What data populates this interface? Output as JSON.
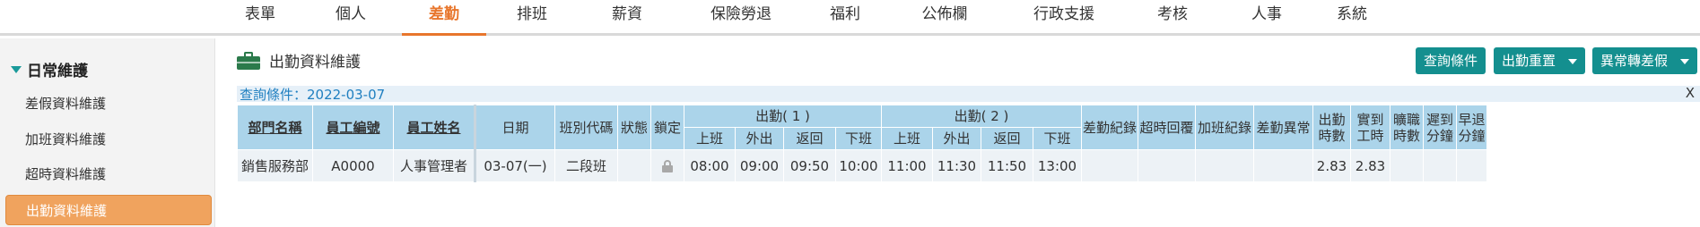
{
  "topnav": {
    "tabs": [
      {
        "label": "表單"
      },
      {
        "label": "個人"
      },
      {
        "label": "差勤"
      },
      {
        "label": "排班"
      },
      {
        "label": "薪資"
      },
      {
        "label": "保險勞退"
      },
      {
        "label": "福利"
      },
      {
        "label": "公佈欄"
      },
      {
        "label": "行政支援"
      },
      {
        "label": "考核"
      },
      {
        "label": "人事"
      },
      {
        "label": "系統"
      }
    ],
    "active_tab": "差勤"
  },
  "sidebar": {
    "group_title": "日常維護",
    "items": [
      {
        "label": "差假資料維護"
      },
      {
        "label": "加班資料維護"
      },
      {
        "label": "超時資料維護"
      },
      {
        "label": "出勤資料維護"
      }
    ],
    "active_item": "出勤資料維護"
  },
  "main": {
    "page_title": "出勤資料維護",
    "buttons": {
      "query": "查詢條件",
      "reset": "出勤重置",
      "convert": "異常轉差假"
    },
    "query_bar": {
      "text": "查詢條件：2022-03-07",
      "close": "X"
    },
    "table": {
      "headers": {
        "dept": "部門名稱",
        "emp_no": "員工編號",
        "emp_name": "員工姓名",
        "date": "日期",
        "shift_code": "班別代碼",
        "status": "狀態",
        "locked": "鎖定",
        "attend1": "出勤( 1 )",
        "attend2": "出勤( 2 )",
        "on": "上班",
        "out": "外出",
        "back": "返回",
        "off": "下班",
        "leave_rec": "差勤紀錄",
        "overtime_reply": "超時回覆",
        "ot_rec": "加班紀錄",
        "abnormal": "差勤異常",
        "attend_hours": "出勤時數",
        "actual_hours": "實到工時",
        "absent_hours": "曠職時數",
        "late_min": "遲到分鐘",
        "early_min": "早退分鐘"
      },
      "rows": [
        {
          "dept": "銷售服務部",
          "emp_no": "A0000",
          "emp_name": "人事管理者",
          "date": "03-07(一)",
          "shift_code": "二段班",
          "status": "",
          "a1_on": "08:00",
          "a1_out": "09:00",
          "a1_back": "09:50",
          "a1_off": "10:00",
          "a2_on": "11:00",
          "a2_out": "11:30",
          "a2_back": "11:50",
          "a2_off": "13:00",
          "leave_rec": "",
          "overtime_reply": "",
          "ot_rec": "",
          "abnormal": "",
          "attend_hours": "2.83",
          "actual_hours": "2.83",
          "absent_hours": "",
          "late_min": "",
          "early_min": ""
        }
      ]
    }
  },
  "colors": {
    "accent": "#e8762c",
    "button": "#148f8f",
    "table_header": "#abd4ea",
    "sidebar_active": "#f0a35e"
  }
}
